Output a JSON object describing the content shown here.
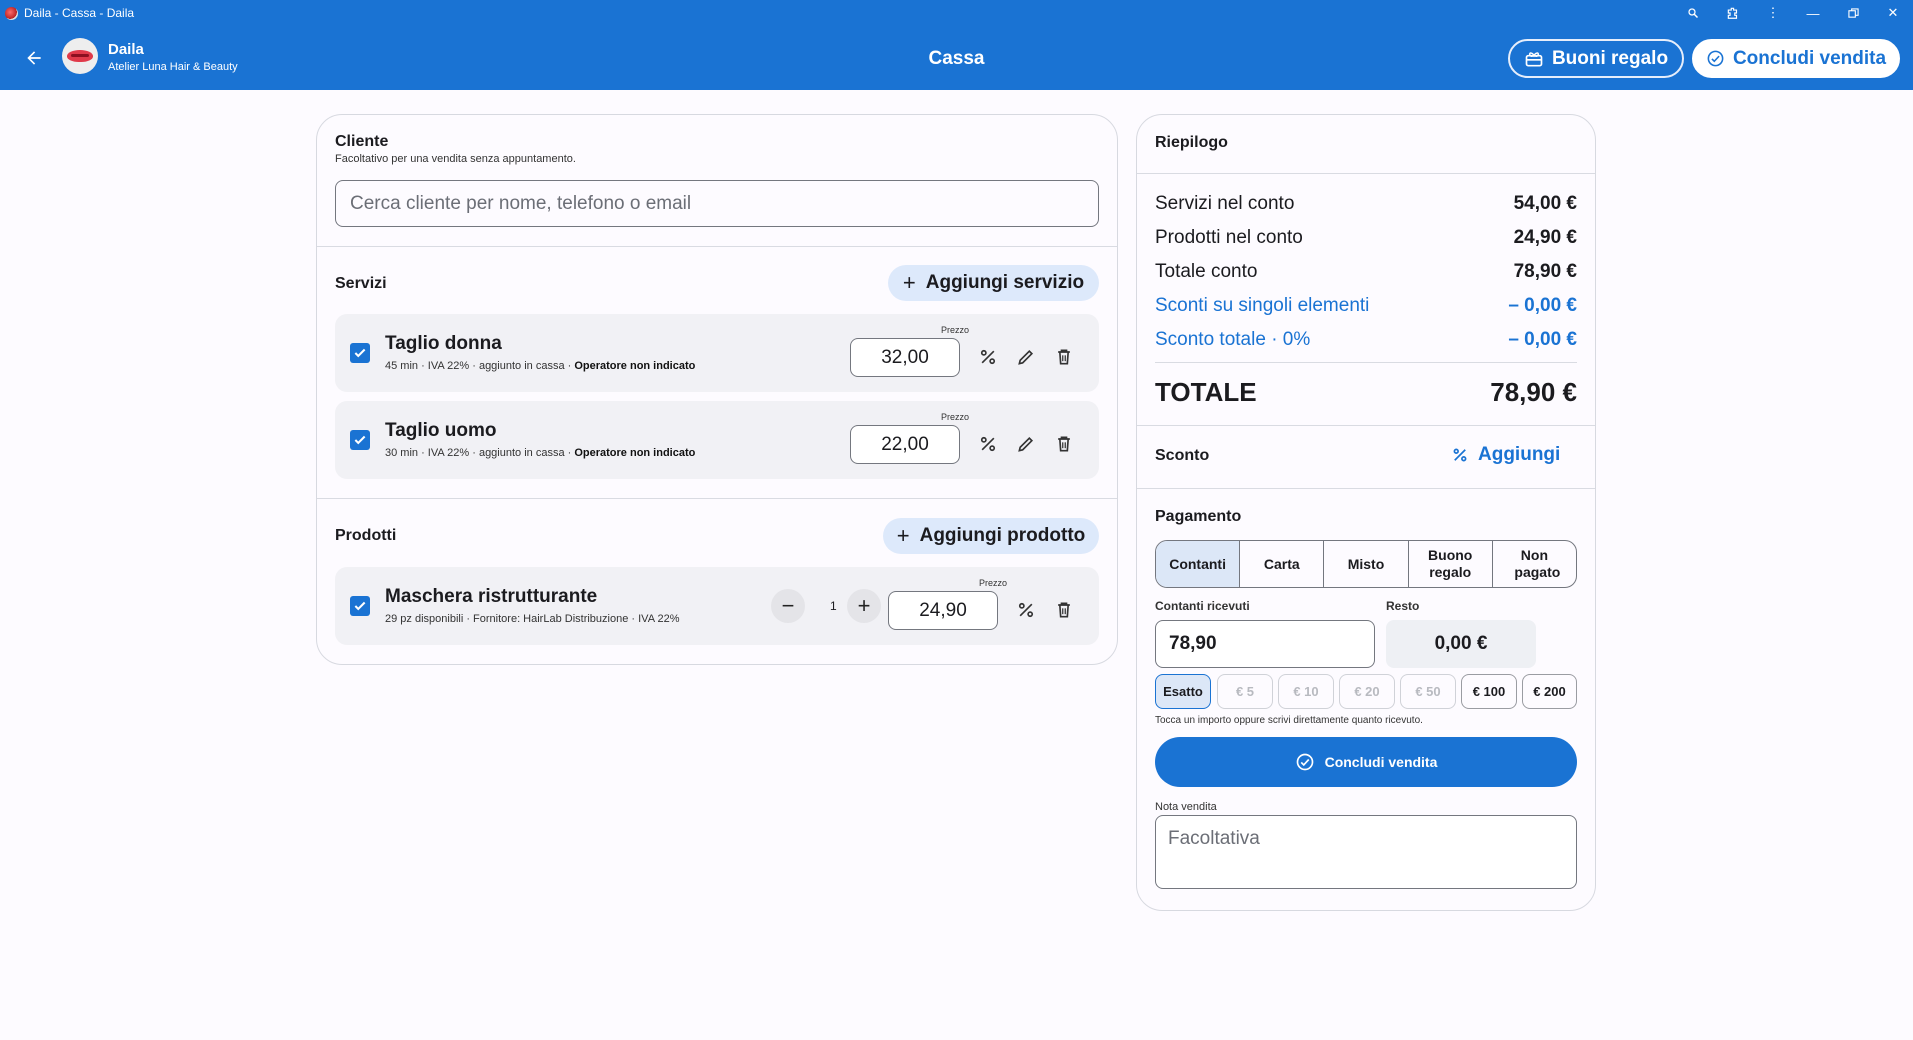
{
  "window": {
    "title": "Daila - Cassa - Daila",
    "controls": [
      "zoom-icon",
      "extension-icon",
      "more-vert-icon",
      "minimize-icon",
      "restore-icon",
      "close-icon"
    ]
  },
  "appbar": {
    "user_name": "Daila",
    "user_subtitle": "Atelier Luna Hair & Beauty",
    "title": "Cassa",
    "gift_button": "Buoni regalo",
    "conclude_button": "Concludi vendita"
  },
  "cliente": {
    "title": "Cliente",
    "subtitle": "Facoltativo per una vendita senza appuntamento.",
    "search_placeholder": "Cerca cliente per nome, telefono o email"
  },
  "servizi": {
    "title": "Servizi",
    "add_label": "Aggiungi servizio",
    "items": [
      {
        "name": "Taglio donna",
        "meta": "45 min · IVA 22% · aggiunto in cassa · ",
        "operator": "Operatore non indicato",
        "price_label": "Prezzo",
        "price": "32,00"
      },
      {
        "name": "Taglio uomo",
        "meta": "30 min · IVA 22% · aggiunto in cassa · ",
        "operator": "Operatore non indicato",
        "price_label": "Prezzo",
        "price": "22,00"
      }
    ]
  },
  "prodotti": {
    "title": "Prodotti",
    "add_label": "Aggiungi prodotto",
    "items": [
      {
        "name": "Maschera ristrutturante",
        "meta": "29 pz disponibili · Fornitore: HairLab Distribuzione · IVA 22%",
        "qty": "1",
        "price_label": "Prezzo",
        "price": "24,90"
      }
    ]
  },
  "riepilogo": {
    "title": "Riepilogo",
    "rows": [
      {
        "label": "Servizi nel conto",
        "value": "54,00 €"
      },
      {
        "label": "Prodotti nel conto",
        "value": "24,90 €"
      },
      {
        "label": "Totale conto",
        "value": "78,90 €"
      },
      {
        "label": "Sconti su singoli elementi",
        "value": "– 0,00 €"
      },
      {
        "label": "Sconto totale · 0%",
        "value": "– 0,00 €"
      }
    ],
    "total_label": "TOTALE",
    "total_value": "78,90 €"
  },
  "sconto": {
    "title": "Sconto",
    "add_label": "Aggiungi"
  },
  "pagamento": {
    "title": "Pagamento",
    "methods": [
      "Contanti",
      "Carta",
      "Misto",
      "Buono regalo",
      "Non pagato"
    ],
    "selected_method": "Contanti",
    "received_label": "Contanti ricevuti",
    "received_value": "78,90",
    "change_label": "Resto",
    "change_value": "0,00 €",
    "chips": [
      "Esatto",
      "€ 5",
      "€ 10",
      "€ 20",
      "€ 50",
      "€ 100",
      "€ 200"
    ],
    "hint": "Tocca un importo oppure scrivi direttamente quanto ricevuto.",
    "conclude_label": "Concludi vendita",
    "note_label": "Nota vendita",
    "note_placeholder": "Facoltativa"
  },
  "colors": {
    "primary": "#1a73d3",
    "tonal": "#dde9fb",
    "surface": "#fdfbff"
  }
}
